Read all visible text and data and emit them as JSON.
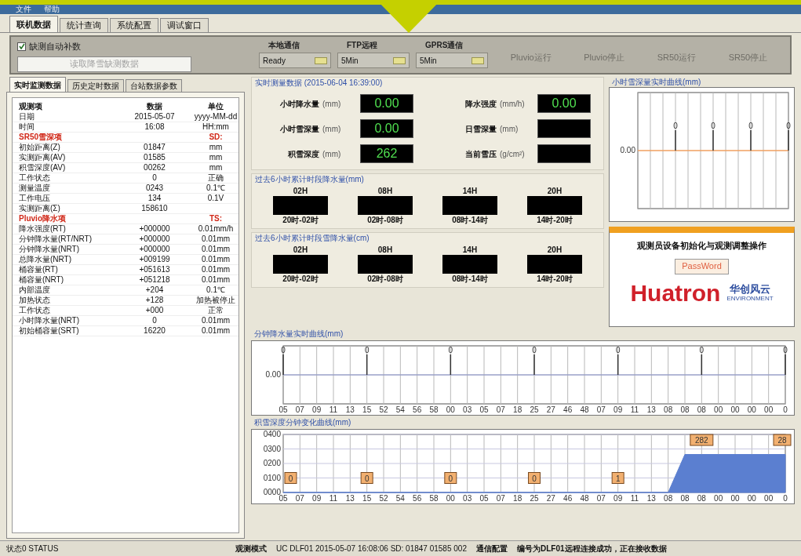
{
  "menu": [
    "文件",
    "帮助"
  ],
  "tabs": [
    {
      "label": "联机数据",
      "selected": true
    },
    {
      "label": "统计查询",
      "selected": false
    },
    {
      "label": "系统配置",
      "selected": false
    },
    {
      "label": "调试窗口",
      "selected": false
    }
  ],
  "control_panel": {
    "auto_fill": {
      "label": "缺测自动补数",
      "checked": true
    },
    "read_button": {
      "label": "读取降雪缺测数据",
      "disabled": true
    },
    "channels": [
      {
        "title": "本地通信",
        "value": "Ready"
      },
      {
        "title": "FTP远程",
        "value": "5Min"
      },
      {
        "title": "GPRS通信",
        "value": "5Min"
      }
    ],
    "actions": [
      {
        "label": "Pluvio运行",
        "disabled": true
      },
      {
        "label": "Pluvio停止",
        "disabled": true
      },
      {
        "label": "SR50运行",
        "disabled": true
      },
      {
        "label": "SR50停止",
        "disabled": true
      }
    ]
  },
  "sub_tabs": [
    {
      "label": "实时监测数据",
      "selected": true
    },
    {
      "label": "历史定时数据",
      "selected": false
    },
    {
      "label": "台站数据参数",
      "selected": false
    }
  ],
  "table": {
    "columns": [
      "观测项",
      "数据",
      "单位"
    ],
    "rows": [
      {
        "kind": "data",
        "item": "日期",
        "value": "2015-05-07",
        "unit": "yyyy-MM-dd"
      },
      {
        "kind": "data",
        "item": "时间",
        "value": "16:08",
        "unit": "HH:mm"
      },
      {
        "kind": "section",
        "item": "SR50雪深项",
        "unit": "SD:"
      },
      {
        "kind": "data",
        "item": "初始距离(Z)",
        "value": "01847",
        "unit": "mm"
      },
      {
        "kind": "data",
        "item": "实测距离(AV)",
        "value": "01585",
        "unit": "mm"
      },
      {
        "kind": "data",
        "item": "积雪深度(AV)",
        "value": "00262",
        "unit": "mm"
      },
      {
        "kind": "data",
        "item": "工作状态",
        "value": "0",
        "unit": "正确"
      },
      {
        "kind": "data",
        "item": "测量温度",
        "value": "0243",
        "unit": "0.1℃"
      },
      {
        "kind": "data",
        "item": "工作电压",
        "value": "134",
        "unit": "0.1V"
      },
      {
        "kind": "data",
        "item": "实测距离(Σ)",
        "value": "158610"
      },
      {
        "kind": "section",
        "item": "Pluvio降水项",
        "unit": "TS:"
      },
      {
        "kind": "data",
        "item": "降水强度(RT)",
        "value": "+000000",
        "unit": "0.01mm/h"
      },
      {
        "kind": "data",
        "item": "分钟降水量(RT/NRT)",
        "value": "+000000",
        "unit": "0.01mm"
      },
      {
        "kind": "data",
        "item": "分钟降水量(NRT)",
        "value": "+000000",
        "unit": "0.01mm"
      },
      {
        "kind": "data",
        "item": "总降水量(NRT)",
        "value": "+009199",
        "unit": "0.01mm"
      },
      {
        "kind": "data",
        "item": "桶容量(RT)",
        "value": "+051613",
        "unit": "0.01mm"
      },
      {
        "kind": "data",
        "item": "桶容量(NRT)",
        "value": "+051218",
        "unit": "0.01mm"
      },
      {
        "kind": "data",
        "item": "内部温度",
        "value": "+204",
        "unit": "0.1℃"
      },
      {
        "kind": "data",
        "item": "加热状态",
        "value": "+128",
        "unit": "加热被停止"
      },
      {
        "kind": "data",
        "item": "工作状态",
        "value": "+000",
        "unit": "正常"
      },
      {
        "kind": "data",
        "item": "小时降水量(NRT)",
        "value": "0",
        "unit": "0.01mm"
      },
      {
        "kind": "data",
        "item": "初始桶容量(SRT)",
        "value": "16220",
        "unit": "0.01mm"
      }
    ]
  },
  "realtime": {
    "title": "实时测量数据 (2015-06-04 16:39:00)",
    "readouts": [
      {
        "label": "小时降水量",
        "unit": "(mm)",
        "value": "0.00"
      },
      {
        "label": "降水强度",
        "unit": "(mm/h)",
        "value": "0.00"
      },
      {
        "label": "小时雪深量",
        "unit": "(mm)",
        "value": "0.00"
      },
      {
        "label": "日雪深量",
        "unit": "(mm)"
      },
      {
        "label": "积雪深度",
        "unit": "(mm)",
        "value": "262"
      },
      {
        "label": "当前雪压",
        "unit": "(g/cm²)"
      }
    ]
  },
  "periods": [
    {
      "title": "过去6小时累计时段降水量(mm)",
      "slots": [
        {
          "head": "02H",
          "range": "20时-02时"
        },
        {
          "head": "08H",
          "range": "02时-08时"
        },
        {
          "head": "14H",
          "range": "08时-14时"
        },
        {
          "head": "20H",
          "range": "14时-20时"
        }
      ]
    },
    {
      "title": "过去6小时累计时段雪降水量(cm)",
      "slots": [
        {
          "head": "02H",
          "range": "20时-02时"
        },
        {
          "head": "08H",
          "range": "02时-08时"
        },
        {
          "head": "14H",
          "range": "08时-14时"
        },
        {
          "head": "20H",
          "range": "14时-20时"
        }
      ]
    }
  ],
  "hourly_chart": {
    "title": "小时雪深量实时曲线(mm)",
    "y_label": "0.00",
    "point_labels": [
      "0",
      "0",
      "0",
      "0"
    ]
  },
  "operator_card": {
    "title": "观测员设备初始化与观测调整操作",
    "button": "PassWord",
    "logo": "Huatron",
    "brand": "华创风云",
    "brand_sub": "ENVIRONMENT"
  },
  "minute_chart": {
    "title": "分钟降水量实时曲线(mm)",
    "y_label": "0.00",
    "x_labels": [
      "05",
      "07",
      "09",
      "11",
      "13",
      "15",
      "52",
      "54",
      "56",
      "58",
      "00",
      "03",
      "05",
      "07",
      "18",
      "25",
      "27",
      "46",
      "48",
      "07",
      "09",
      "11",
      "13",
      "08",
      "08",
      "08",
      "00",
      "00",
      "00",
      "00",
      "0"
    ],
    "point_labels": [
      "0",
      "0",
      "0",
      "0",
      "0",
      "0",
      "0"
    ]
  },
  "depth_chart": {
    "title": "积雪深度分钟变化曲线(mm)",
    "chart_data": {
      "type": "area",
      "grid": true,
      "ylim": [
        0,
        400
      ],
      "yticks": [
        {
          "value": 0,
          "label": "0000"
        },
        {
          "value": 100,
          "label": "0100"
        },
        {
          "value": 200,
          "label": "0200"
        },
        {
          "value": 300,
          "label": "0300"
        },
        {
          "value": 400,
          "label": "0400"
        }
      ],
      "categories": [
        "05",
        "07",
        "09",
        "11",
        "13",
        "15",
        "52",
        "54",
        "56",
        "58",
        "00",
        "03",
        "05",
        "07",
        "18",
        "25",
        "27",
        "46",
        "48",
        "07",
        "09",
        "11",
        "13",
        "08",
        "08",
        "08",
        "00",
        "00",
        "00",
        "00",
        "0"
      ],
      "series": [
        {
          "color": "#5b7fd0",
          "values": [
            0,
            0,
            0,
            0,
            0,
            0,
            0,
            0,
            0,
            0,
            0,
            0,
            0,
            0,
            0,
            0,
            0,
            0,
            0,
            0,
            0,
            0,
            0,
            0,
            262,
            262,
            262,
            262,
            262,
            262,
            262
          ]
        }
      ],
      "value_labels": [
        "0",
        null,
        null,
        null,
        null,
        "0",
        null,
        null,
        null,
        null,
        "0",
        null,
        null,
        null,
        null,
        "0",
        null,
        null,
        null,
        null,
        "1",
        null,
        null,
        null,
        null,
        "282",
        null,
        null,
        null,
        null,
        "28"
      ]
    }
  },
  "status_bar": {
    "state": "状态0 STATUS",
    "mode": "观测模式",
    "record": "UC DLF01 2015-05-07 16:08:06 SD: 01847 01585 002",
    "config": "通信配置",
    "message": "编号为DLF01远程连接成功，正在接收数据"
  }
}
